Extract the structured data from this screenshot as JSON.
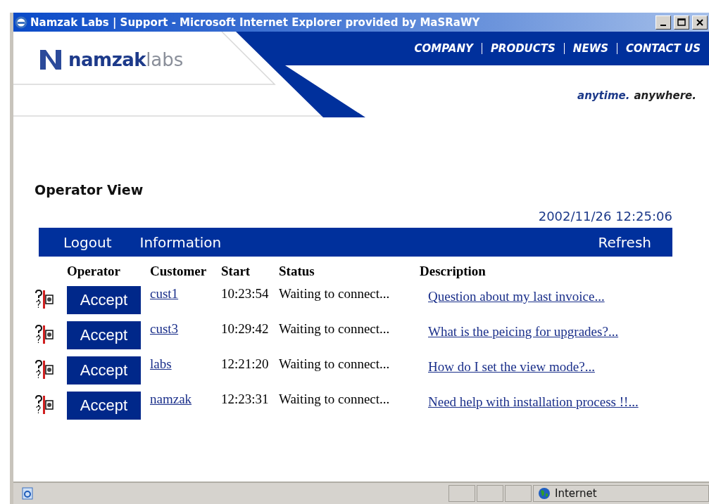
{
  "window": {
    "title": "Namzak Labs | Support - Microsoft Internet Explorer provided by MaSRaWY"
  },
  "header": {
    "logo_bold": "namzak",
    "logo_light": "labs",
    "nav": [
      "COMPANY",
      "PRODUCTS",
      "NEWS",
      "CONTACT US"
    ],
    "tagline_accent": "anytime.",
    "tagline": "anywhere."
  },
  "page_title": "Operator View",
  "timestamp": "2002/11/26 12:25:06",
  "toolbar": {
    "left": [
      "Logout",
      "Information"
    ],
    "right": "Refresh"
  },
  "table": {
    "columns": [
      "Operator",
      "Customer",
      "Start",
      "Status",
      "Description"
    ],
    "rows": [
      {
        "action": "Accept",
        "customer": "cust1",
        "start": "10:23:54",
        "status": "Waiting to connect...",
        "description": "Question about my last invoice..."
      },
      {
        "action": "Accept",
        "customer": "cust3",
        "start": "10:29:42",
        "status": "Waiting to connect...",
        "description": "What is the peicing for upgrades?..."
      },
      {
        "action": "Accept",
        "customer": "labs",
        "start": "12:21:20",
        "status": "Waiting to connect...",
        "description": "How do I set the view mode?..."
      },
      {
        "action": "Accept",
        "customer": "namzak",
        "start": "12:23:31",
        "status": "Waiting to connect...",
        "description": "Need help with installation process !!..."
      }
    ]
  },
  "status_bar": {
    "zone": "Internet"
  }
}
